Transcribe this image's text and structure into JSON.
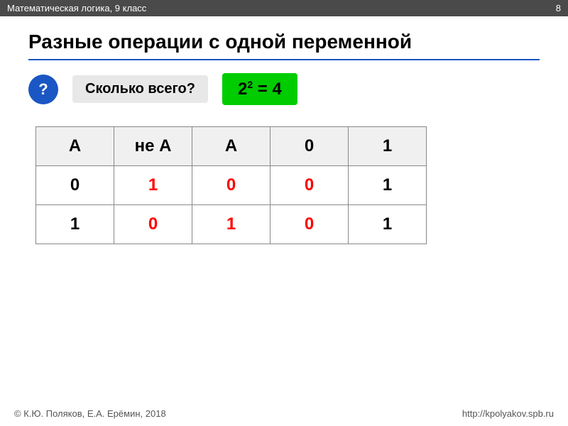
{
  "topbar": {
    "subject": "Математическая логика, 9 класс",
    "page": "8"
  },
  "title": "Разные операции с одной переменной",
  "question": {
    "icon": "?",
    "label": "Сколько всего?",
    "answer_base": "2",
    "answer_exp": "2",
    "answer_result": " = 4"
  },
  "table": {
    "headers": [
      "A",
      "не А",
      "A",
      "0",
      "1"
    ],
    "rows": [
      {
        "cells": [
          {
            "value": "0",
            "color": "black"
          },
          {
            "value": "1",
            "color": "red"
          },
          {
            "value": "0",
            "color": "red"
          },
          {
            "value": "0",
            "color": "red"
          },
          {
            "value": "1",
            "color": "black"
          }
        ]
      },
      {
        "cells": [
          {
            "value": "1",
            "color": "black"
          },
          {
            "value": "0",
            "color": "red"
          },
          {
            "value": "1",
            "color": "red"
          },
          {
            "value": "0",
            "color": "red"
          },
          {
            "value": "1",
            "color": "black"
          }
        ]
      }
    ]
  },
  "footer": {
    "left": "© К.Ю. Поляков, Е.А. Ерёмин, 2018",
    "right": "http://kpolyakov.spb.ru"
  }
}
